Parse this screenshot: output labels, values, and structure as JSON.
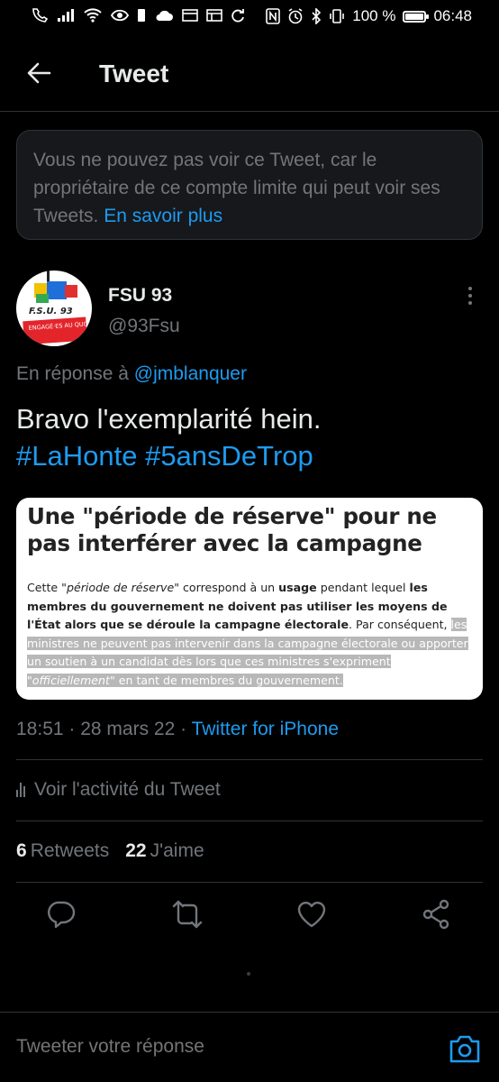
{
  "status_bar": {
    "battery_text": "100 %",
    "time": "06:48",
    "battery_level": 1.0,
    "left_icons": [
      "phone-wifi-icon",
      "signal-icon",
      "wifi-icon",
      "eye-icon",
      "sim-icon",
      "cloud-icon",
      "gallery-icon",
      "gallery-icon",
      "sync-icon"
    ],
    "right_icons": [
      "nfc-icon",
      "alarm-icon",
      "bluetooth-icon",
      "vibrate-icon"
    ]
  },
  "header": {
    "title": "Tweet"
  },
  "notice": {
    "text": "Vous ne pouvez pas voir ce Tweet, car le propriétaire de ce compte limite qui peut voir ses Tweets. ",
    "link": "En savoir plus"
  },
  "tweet": {
    "author_name": "FSU 93",
    "author_handle": "@93Fsu",
    "avatar_text": "F.S.U. 93",
    "avatar_tag": "ENGAGÉ·ES AU QUOTIDIEN",
    "reply_prefix": "En réponse à ",
    "reply_handle": "@jmblanquer",
    "text_line": "Bravo l'exemplarité hein.",
    "hashtags": [
      "#LaHonte",
      "#5ansDeTrop"
    ],
    "media": {
      "title": "Une \"période de réserve\" pour ne pas interférer avec la campagne",
      "p1": "Cette \"",
      "p1_em": "période de réserve",
      "p2": "\" correspond à un ",
      "p2_b": "usage",
      "p3": " pendant lequel ",
      "p3_b": "les membres du gouvernement ne doivent pas utiliser les moyens de l'État alors que se déroule la campagne électorale",
      "p4": ". Par conséquent, ",
      "hl1": "les ministres ne peuvent pas intervenir dans la campagne électorale ou apporter un soutien à un candidat dès lors que ces ministres s'expriment \"",
      "hl_em": "officiellement",
      "hl2": "\" en tant de membres du gouvernement",
      "end": "."
    },
    "time": "18:51",
    "date": "28 mars 22",
    "source": "Twitter for iPhone",
    "activity_label": "Voir l'activité du Tweet",
    "retweets_count": "6",
    "retweets_label": "Retweets",
    "likes_count": "22",
    "likes_label": "J'aime"
  },
  "composer": {
    "placeholder": "Tweeter votre réponse"
  },
  "colors": {
    "background": "#000000",
    "accent": "#1d9bf0",
    "secondary_text": "#71767b",
    "border": "#2f3336"
  }
}
